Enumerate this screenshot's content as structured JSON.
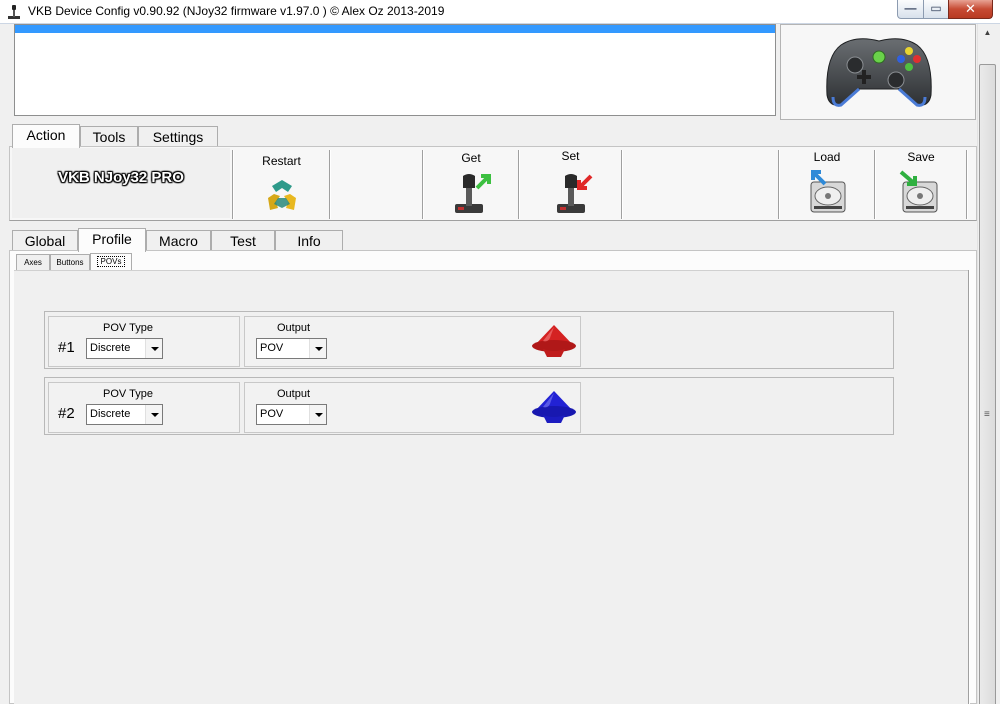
{
  "window": {
    "title": "VKB Device Config v0.90.92 (NJoy32 firmware v1.97.0  ) © Alex Oz 2013-2019",
    "buttons": {
      "minimize": "—",
      "maximize": "▭",
      "close": "✕"
    }
  },
  "main_tabs": [
    {
      "label": "Action",
      "active": true
    },
    {
      "label": "Tools",
      "active": false
    },
    {
      "label": "Settings",
      "active": false
    }
  ],
  "device": {
    "name": "VKB NJoy32 PRO"
  },
  "actions": {
    "restart": {
      "label": "Restart",
      "icon": "recycle-arrows-icon"
    },
    "get": {
      "label": "Get",
      "icon": "joystick-get-icon"
    },
    "set": {
      "label": "Set",
      "icon": "joystick-set-icon"
    },
    "load": {
      "label": "Load",
      "icon": "disk-load-icon"
    },
    "save": {
      "label": "Save",
      "icon": "disk-save-icon"
    }
  },
  "section_tabs": [
    {
      "label": "Global",
      "active": false
    },
    {
      "label": "Profile",
      "active": true
    },
    {
      "label": "Macro",
      "active": false
    },
    {
      "label": "Test",
      "active": false
    },
    {
      "label": "Info",
      "active": false
    }
  ],
  "profile_tabs": [
    {
      "label": "Axes",
      "active": false
    },
    {
      "label": "Buttons",
      "active": false
    },
    {
      "label": "POVs",
      "active": true
    }
  ],
  "povs": [
    {
      "number": "#1",
      "type_label": "POV Type",
      "type_value": "Discrete",
      "output_label": "Output",
      "output_value": "POV",
      "hat_color": "#d42222"
    },
    {
      "number": "#2",
      "type_label": "POV Type",
      "type_value": "Discrete",
      "output_label": "Output",
      "output_value": "POV",
      "hat_color": "#2222d4"
    }
  ],
  "colors": {
    "selection": "#3399ff",
    "panel": "#f0f0f0"
  }
}
